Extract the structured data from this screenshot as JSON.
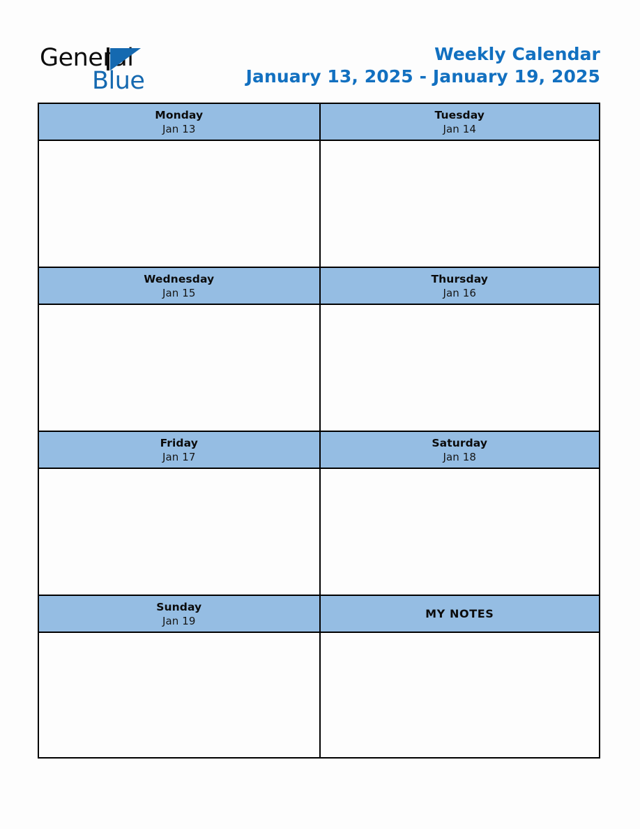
{
  "brand": {
    "name_part1": "General",
    "name_part2": "Blue",
    "mark": "triangle-logo",
    "color_dark": "#0d0d0d",
    "color_blue": "#1569b0"
  },
  "header": {
    "title": "Weekly Calendar",
    "date_range": "January 13, 2025 - January 19, 2025",
    "title_color": "#1270c0"
  },
  "theme": {
    "header_cell_background": "#95bde3",
    "body_cell_background": "#fdfdfd",
    "border_color": "#000000",
    "page_background": "#fdfdfd"
  },
  "calendar": {
    "rows": [
      {
        "cells": [
          {
            "type": "day",
            "day_name": "Monday",
            "day_date": "Jan 13",
            "content": ""
          },
          {
            "type": "day",
            "day_name": "Tuesday",
            "day_date": "Jan 14",
            "content": ""
          }
        ]
      },
      {
        "cells": [
          {
            "type": "day",
            "day_name": "Wednesday",
            "day_date": "Jan 15",
            "content": ""
          },
          {
            "type": "day",
            "day_name": "Thursday",
            "day_date": "Jan 16",
            "content": ""
          }
        ]
      },
      {
        "cells": [
          {
            "type": "day",
            "day_name": "Friday",
            "day_date": "Jan 17",
            "content": ""
          },
          {
            "type": "day",
            "day_name": "Saturday",
            "day_date": "Jan 18",
            "content": ""
          }
        ]
      },
      {
        "cells": [
          {
            "type": "day",
            "day_name": "Sunday",
            "day_date": "Jan 19",
            "content": ""
          },
          {
            "type": "notes",
            "day_name": "MY NOTES",
            "day_date": "",
            "content": ""
          }
        ]
      }
    ]
  }
}
